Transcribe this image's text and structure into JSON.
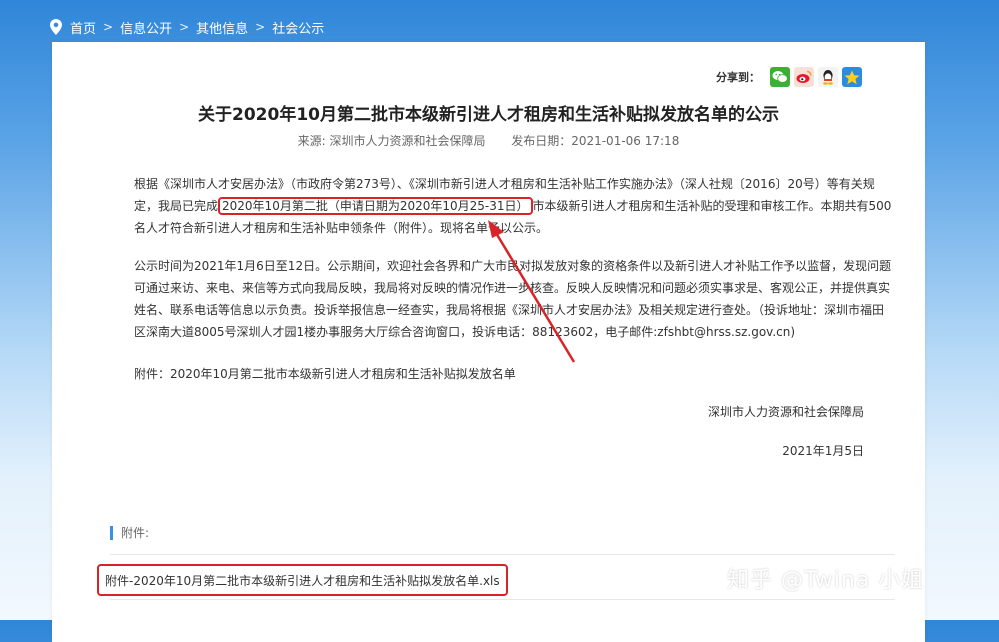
{
  "breadcrumb": [
    "首页",
    "信息公开",
    "其他信息",
    "社会公示"
  ],
  "share": {
    "label": "分享到：",
    "icons": [
      "wechat-icon",
      "weibo-icon",
      "qq-icon",
      "qzone-icon"
    ]
  },
  "article": {
    "title": "关于2020年10月第二批市本级新引进人才租房和生活补贴拟发放名单的公示",
    "source": "来源: 深圳市人力资源和社会保障局",
    "date": "发布日期：2021-01-06 17:18",
    "p1_a": "根据《深圳市人才安居办法》（市政府令第273号）、《深圳市新引进人才租房和生活补贴工作实施办法》（深人社规〔2016〕20号）等有关规定，我局已完成",
    "p1_highlight": "2020年10月第二批（申请日期为2020年10月25-31日）",
    "p1_b": "市本级新引进人才租房和生活补贴的受理和审核工作。本期共有500名人才符合新引进人才租房和生活补贴申领条件（附件）。现将名单予以公示。",
    "p2": "公示时间为2021年1月6日至12日。公示期间，欢迎社会各界和广大市民对拟发放对象的资格条件以及新引进人才补贴工作予以监督，发现问题可通过来访、来电、来信等方式向我局反映，我局将对反映的情况作进一步核查。反映人反映情况和问题必须实事求是、客观公正，并提供真实姓名、联系电话等信息以示负责。投诉举报信息一经查实，我局将根据《深圳市人才安居办法》及相关规定进行查处。（投诉地址：深圳市福田区深南大道8005号深圳人才园1楼办事服务大厅综合咨询窗口，投诉电话：88123602，电子邮件:zfshbt@hrss.sz.gov.cn)",
    "p3": "附件：2020年10月第二批市本级新引进人才租房和生活补贴拟发放名单",
    "signature": "深圳市人力资源和社会保障局",
    "sign_date": "2021年1月5日"
  },
  "attachments": {
    "heading": "附件:",
    "file": "附件-2020年10月第二批市本级新引进人才租房和生活补贴拟发放名单.xls"
  },
  "watermark": "知乎 @Twina 小姐",
  "colors": {
    "highlight": "#d9232a",
    "accent": "#3a8ee6",
    "background_top": "#2f86d8"
  }
}
